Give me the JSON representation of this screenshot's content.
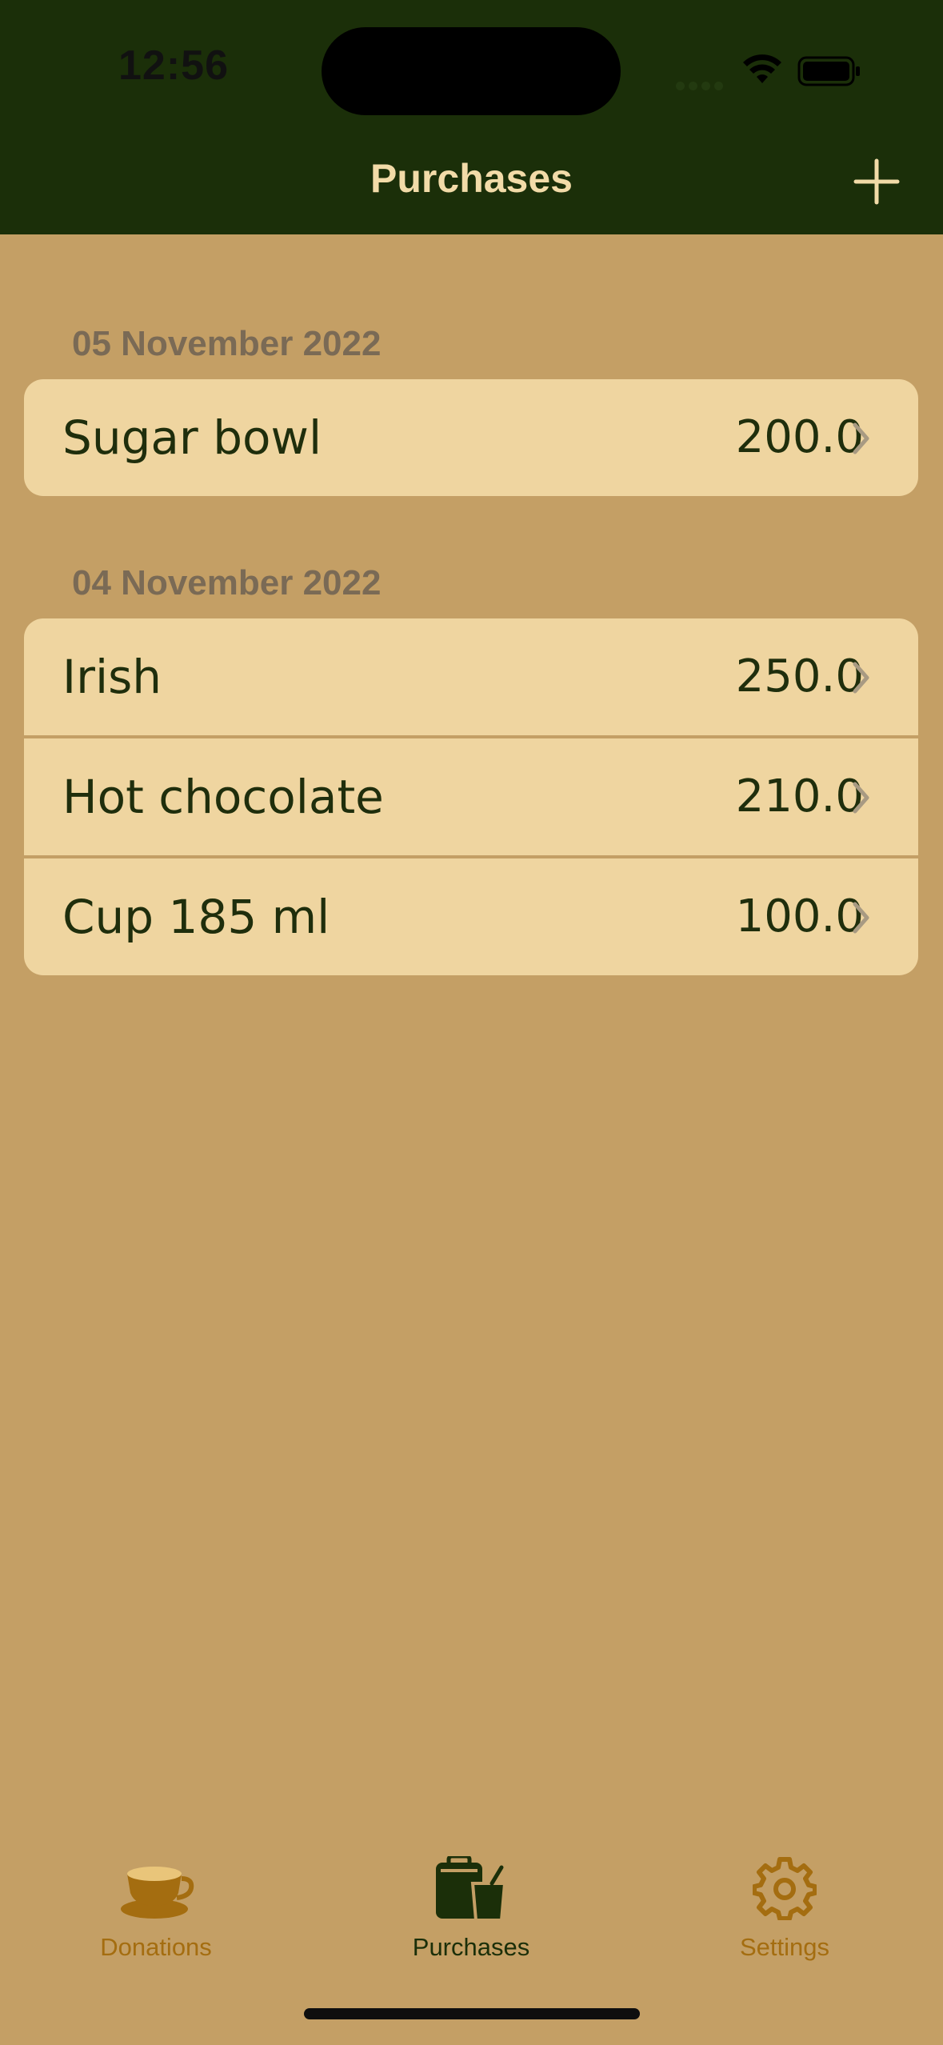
{
  "status_bar": {
    "time": "12:56"
  },
  "nav": {
    "title": "Purchases",
    "add_icon": "plus-icon"
  },
  "sections": [
    {
      "date": "05 November 2022",
      "items": [
        {
          "name": "Sugar bowl",
          "amount": "200.0"
        }
      ]
    },
    {
      "date": "04 November 2022",
      "items": [
        {
          "name": "Irish",
          "amount": "250.0"
        },
        {
          "name": "Hot chocolate",
          "amount": "210.0"
        },
        {
          "name": "Cup 185 ml",
          "amount": "100.0"
        }
      ]
    }
  ],
  "tabs": [
    {
      "label": "Donations",
      "icon": "coffee-cup-icon",
      "selected": false
    },
    {
      "label": "Purchases",
      "icon": "purchases-icon",
      "selected": true
    },
    {
      "label": "Settings",
      "icon": "gear-icon",
      "selected": false
    }
  ],
  "colors": {
    "background": "#c49f65",
    "header": "#1b2f09",
    "row": "#efd5a0",
    "tab_active": "#1b2f09",
    "tab_inactive": "#a46d10",
    "section_header": "#7a6a55"
  }
}
